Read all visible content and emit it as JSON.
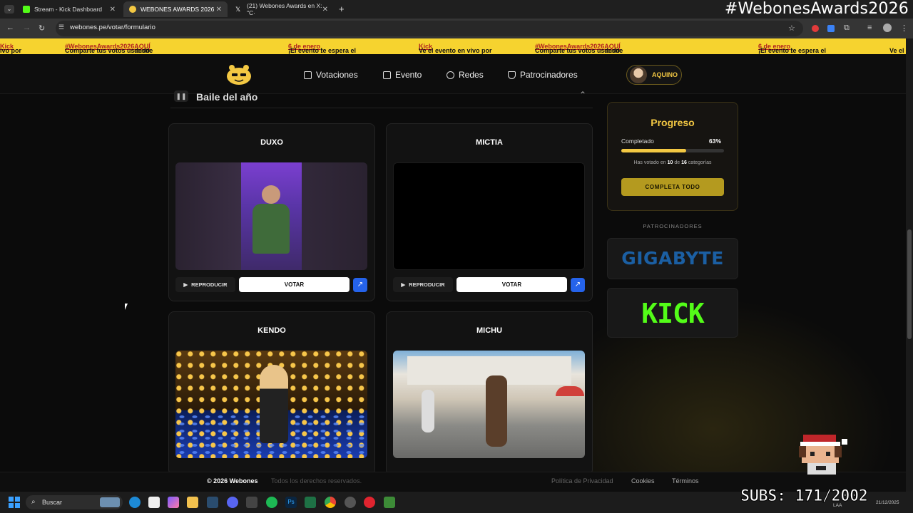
{
  "browser": {
    "tabs": [
      {
        "title": "Stream - Kick Dashboard",
        "active": false
      },
      {
        "title": "WEBONES AWARDS 2026",
        "active": true
      },
      {
        "title": "(21) Webones Awards en X: \"C·",
        "active": false
      }
    ],
    "url": "webones.pe/votar/formulario"
  },
  "overlay": {
    "hashtag": "#WebonesAwards2026",
    "subs": "SUBS: 171/2002"
  },
  "ticker": [
    {
      "pre": "ivo por ",
      "link": "Kick",
      "post": ""
    },
    {
      "pre": "Comparte tus votos usando ",
      "link": "#WebonesAwards2026",
      "post": " desde ",
      "link2": "AQUÍ"
    },
    {
      "pre": "¡El evento te espera el ",
      "link": "6 de enero",
      "post": "!"
    },
    {
      "pre": "Ve el evento en vivo por ",
      "link": "Kick",
      "post": ""
    },
    {
      "pre": "Comparte tus votos usando ",
      "link": "#WebonesAwards2026",
      "post": " desde ",
      "link2": "AQUÍ"
    },
    {
      "pre": "¡El evento te espera el ",
      "link": "6 de enero",
      "post": "!"
    },
    {
      "pre": "Ve el",
      "link": "",
      "post": ""
    }
  ],
  "nav": {
    "items": [
      "Votaciones",
      "Evento",
      "Redes",
      "Patrocinadores"
    ],
    "user": "AQUINO"
  },
  "category": {
    "title": "Baile del año"
  },
  "nominees": [
    {
      "name": "DUXO"
    },
    {
      "name": "MICTIA"
    },
    {
      "name": "KENDO"
    },
    {
      "name": "MICHU"
    }
  ],
  "buttons": {
    "play": "REPRODUCIR",
    "vote": "VOTAR"
  },
  "progress": {
    "title": "Progreso",
    "completed_label": "Completado",
    "percent": 63,
    "percent_label": "63%",
    "voted_prefix": "Has votado en ",
    "voted_count": "10",
    "voted_mid": " de ",
    "voted_total": "16",
    "voted_suffix": " categorías",
    "complete_all": "COMPLETA TODO"
  },
  "sponsors": {
    "label": "PATROCINADORES",
    "items": [
      "GIGABYTE",
      "KICK"
    ]
  },
  "footer": {
    "copyright": "© 2026 Webones",
    "rights": "Todos los derechos reservados.",
    "links": [
      "Política de Privacidad",
      "Cookies",
      "Términos"
    ]
  },
  "taskbar": {
    "search_placeholder": "Buscar",
    "date": "21/12/2025",
    "lang": "LAA"
  },
  "colors": {
    "accent": "#f3c843",
    "ticker_bg": "#f6d32f",
    "kick_green": "#53fc18",
    "gigabyte_blue": "#1b5fa3",
    "ext_blue": "#2563eb"
  }
}
